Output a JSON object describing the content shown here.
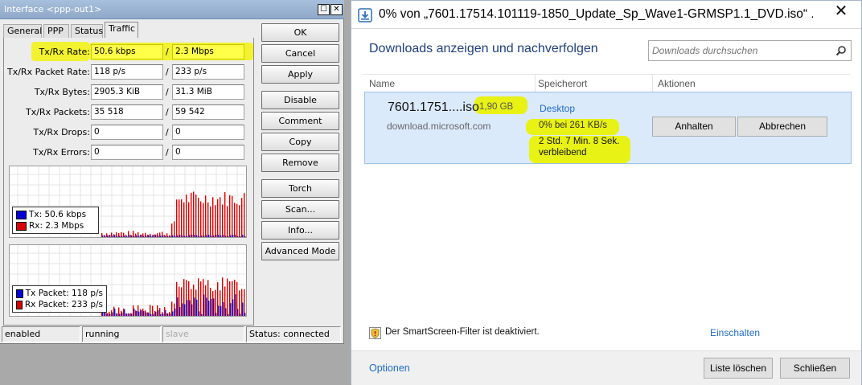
{
  "winbox": {
    "title": "Interface <ppp-out1>",
    "titlebar_buttons": {
      "maximize": "☐",
      "close": "✕"
    },
    "tabs": [
      {
        "label": "General"
      },
      {
        "label": "PPP"
      },
      {
        "label": "Status"
      },
      {
        "label": "Traffic",
        "active": true
      }
    ],
    "stats": [
      {
        "label": "Tx/Rx Rate:",
        "tx": "50.6 kbps",
        "rx": "2.3 Mbps",
        "highlighted": true
      },
      {
        "label": "Tx/Rx Packet Rate:",
        "tx": "118 p/s",
        "rx": "233 p/s"
      },
      {
        "label": "Tx/Rx Bytes:",
        "tx": "2905.3 KiB",
        "rx": "31.3 MiB"
      },
      {
        "label": "Tx/Rx Packets:",
        "tx": "35 518",
        "rx": "59 542"
      },
      {
        "label": "Tx/Rx Drops:",
        "tx": "0",
        "rx": "0"
      },
      {
        "label": "Tx/Rx Errors:",
        "tx": "0",
        "rx": "0"
      }
    ],
    "separator": "/",
    "rate_legend": {
      "tx": "Tx:  50.6 kbps",
      "rx": "Rx:  2.3 Mbps"
    },
    "packet_legend": {
      "tx": "Tx Packet:  118 p/s",
      "rx": "Rx Packet:  233 p/s"
    },
    "colors": {
      "tx": "#0000d8",
      "rx": "#d80000",
      "highlight": "#f2f230"
    },
    "buttons": [
      "OK",
      "Cancel",
      "Apply",
      "Disable",
      "Comment",
      "Copy",
      "Remove",
      "Torch",
      "Scan...",
      "Info...",
      "Advanced Mode"
    ],
    "statusbar": {
      "enabled": "enabled",
      "running": "running",
      "slave": "slave",
      "status": "Status: connected"
    }
  },
  "ie": {
    "title": "0% von „7601.17514.101119-1850_Update_Sp_Wave1-GRMSP1.1_DVD.iso“ ...",
    "close_glyph": "✕",
    "heading": "Downloads anzeigen und nachverfolgen",
    "search_placeholder": "Downloads durchsuchen",
    "columns": {
      "name": "Name",
      "location": "Speicherort",
      "actions": "Aktionen"
    },
    "download": {
      "filename": "7601.1751....iso",
      "size": "1,90 GB",
      "source": "download.microsoft.com",
      "location": "Desktop",
      "progress": "0% bei 261 KB/s",
      "remaining": "2 Std. 7 Min. 8 Sek. verbleibend",
      "pause_label": "Anhalten",
      "cancel_label": "Abbrechen"
    },
    "smartscreen": {
      "text": "Der SmartScreen-Filter ist deaktiviert.",
      "enable_label": "Einschalten"
    },
    "footer": {
      "options_label": "Optionen",
      "clear_label": "Liste löschen",
      "close_label": "Schließen"
    },
    "colors": {
      "link": "#1f6ac2",
      "heading": "#1e3f7a",
      "selection": "#dbeafb",
      "highlight": "#e8f214"
    }
  }
}
